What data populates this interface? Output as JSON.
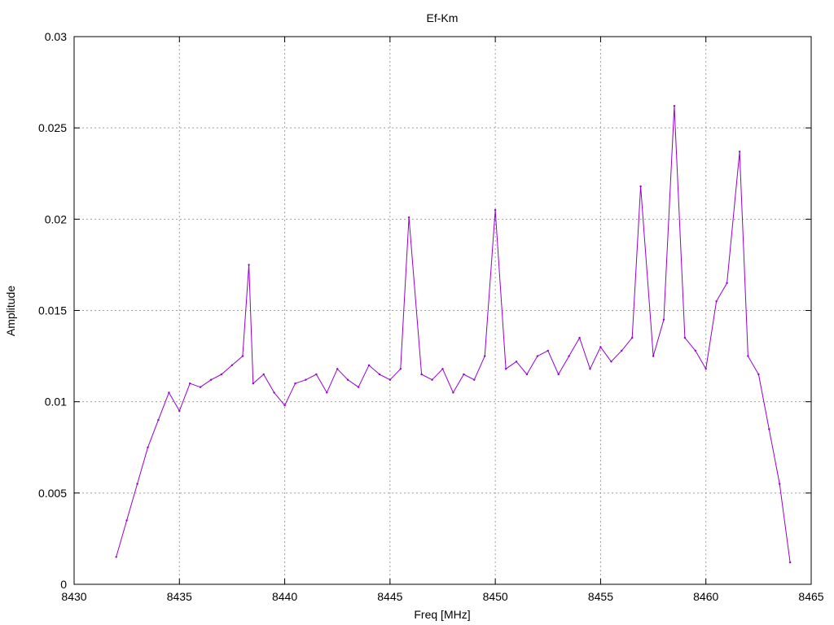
{
  "chart_data": {
    "type": "line",
    "title": "Ef-Km",
    "xlabel": "Freq [MHz]",
    "ylabel": "Amplitude",
    "xlim": [
      8430,
      8465
    ],
    "ylim": [
      0,
      0.03
    ],
    "xticks": [
      8430,
      8435,
      8440,
      8445,
      8450,
      8455,
      8460,
      8465
    ],
    "xtick_labels": [
      "8430",
      "8435",
      "8440",
      "8445",
      "8450",
      "8455",
      "8460",
      "8465"
    ],
    "yticks": [
      0,
      0.005,
      0.01,
      0.015,
      0.02,
      0.025,
      0.03
    ],
    "ytick_labels": [
      "0",
      "0.005",
      "0.01",
      "0.015",
      "0.02",
      "0.025",
      "0.03"
    ],
    "grid": true,
    "series_color": "#9400d3",
    "series": [
      {
        "x": [
          8432.0,
          8432.5,
          8433.0,
          8433.5,
          8434.0,
          8434.5,
          8435.0,
          8435.5,
          8436.0,
          8436.5,
          8437.0,
          8437.5,
          8438.0,
          8438.3,
          8438.5,
          8439.0,
          8439.5,
          8440.0,
          8440.5,
          8441.0,
          8441.5,
          8442.0,
          8442.5,
          8443.0,
          8443.5,
          8444.0,
          8444.5,
          8445.0,
          8445.5,
          8445.9,
          8446.5,
          8447.0,
          8447.5,
          8448.0,
          8448.5,
          8449.0,
          8449.5,
          8450.0,
          8450.5,
          8451.0,
          8451.5,
          8452.0,
          8452.5,
          8453.0,
          8453.5,
          8454.0,
          8454.5,
          8455.0,
          8455.5,
          8456.0,
          8456.5,
          8456.9,
          8457.5,
          8458.0,
          8458.5,
          8459.0,
          8459.5,
          8460.0,
          8460.5,
          8461.0,
          8461.6,
          8462.0,
          8462.5,
          8463.0,
          8463.5,
          8464.0
        ],
        "y": [
          0.0015,
          0.0035,
          0.0055,
          0.0075,
          0.009,
          0.0105,
          0.0095,
          0.011,
          0.0108,
          0.0112,
          0.0115,
          0.012,
          0.0125,
          0.0175,
          0.011,
          0.0115,
          0.0105,
          0.0098,
          0.011,
          0.0112,
          0.0115,
          0.0105,
          0.0118,
          0.0112,
          0.0108,
          0.012,
          0.0115,
          0.0112,
          0.0118,
          0.0201,
          0.0115,
          0.0112,
          0.0118,
          0.0105,
          0.0115,
          0.0112,
          0.0125,
          0.0205,
          0.0118,
          0.0122,
          0.0115,
          0.0125,
          0.0128,
          0.0115,
          0.0125,
          0.0135,
          0.0118,
          0.013,
          0.0122,
          0.0128,
          0.0135,
          0.0218,
          0.0125,
          0.0145,
          0.0262,
          0.0135,
          0.0128,
          0.0118,
          0.0155,
          0.0165,
          0.0237,
          0.0125,
          0.0115,
          0.0085,
          0.0055,
          0.0012
        ]
      }
    ]
  }
}
